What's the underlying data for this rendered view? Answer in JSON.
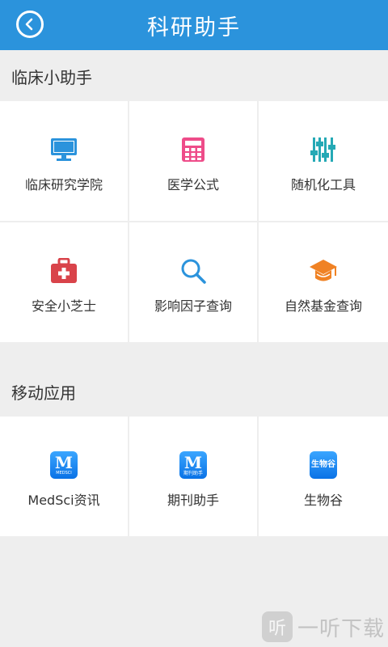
{
  "header": {
    "title": "科研助手",
    "back_icon": "chevron-left-icon"
  },
  "sections": [
    {
      "title": "临床小助手",
      "items": [
        {
          "label": "临床研究学院",
          "icon": "monitor-icon",
          "color": "#2b93dc"
        },
        {
          "label": "医学公式",
          "icon": "calculator-icon",
          "color": "#ee4c89"
        },
        {
          "label": "随机化工具",
          "icon": "sliders-icon",
          "color": "#25a9b5"
        },
        {
          "label": "安全小芝士",
          "icon": "first-aid-kit-icon",
          "color": "#d9434a"
        },
        {
          "label": "影响因子查询",
          "icon": "search-icon",
          "color": "#2b93dc"
        },
        {
          "label": "自然基金查询",
          "icon": "graduation-cap-icon",
          "color": "#f08224"
        }
      ]
    },
    {
      "title": "移动应用",
      "items": [
        {
          "label": "MedSci资讯",
          "icon": "medsci-app-icon",
          "glyph": "M",
          "sub": "MEDSCI"
        },
        {
          "label": "期刊助手",
          "icon": "journal-app-icon",
          "glyph": "M",
          "sub": "期刊助手"
        },
        {
          "label": "生物谷",
          "icon": "bioon-app-icon",
          "glyph": "生物谷"
        }
      ]
    }
  ],
  "watermark": {
    "icon_glyph": "听",
    "text": "一听下载"
  }
}
